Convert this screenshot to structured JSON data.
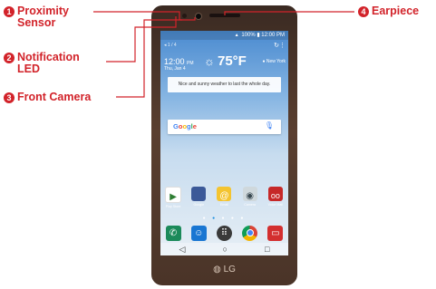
{
  "callouts": [
    {
      "num": "1",
      "label_lines": [
        "Proximity",
        "Sensor"
      ]
    },
    {
      "num": "2",
      "label_lines": [
        "Notification",
        "LED"
      ]
    },
    {
      "num": "3",
      "label_lines": [
        "Front Camera"
      ]
    },
    {
      "num": "4",
      "label_lines": [
        "Earpiece"
      ]
    }
  ],
  "colors": {
    "accent": "#d2232a"
  },
  "phone": {
    "status_bar": "100% ▮ 12:00 PM",
    "weather": {
      "small": "◂ 1 / 4",
      "time": "12:00",
      "ampm": "PM",
      "date": "Thu, Jan 4",
      "temp": "75°F",
      "location": "● New York",
      "message": "Nice and sunny weather to last the whole day."
    },
    "google_label": "Google",
    "apps": [
      {
        "label": "Play Store",
        "color": "#2e7d32"
      },
      {
        "label": "Google",
        "color": "#3b5998"
      },
      {
        "label": "Email",
        "color": "#f4c430"
      },
      {
        "label": "Camera",
        "color": "#4f5b66"
      },
      {
        "label": "Voice Mail",
        "color": "#c62828"
      }
    ],
    "dock": [
      {
        "icon": "phone-icon",
        "color": "#1b8a5a"
      },
      {
        "icon": "contacts-icon",
        "color": "#1976d2"
      },
      {
        "icon": "apps-drawer-icon",
        "color": "#3a3a3a"
      },
      {
        "icon": "chrome-icon",
        "color": "#e04a2f"
      },
      {
        "icon": "messaging-icon",
        "color": "#d32f2f"
      }
    ],
    "brand": "LG"
  }
}
